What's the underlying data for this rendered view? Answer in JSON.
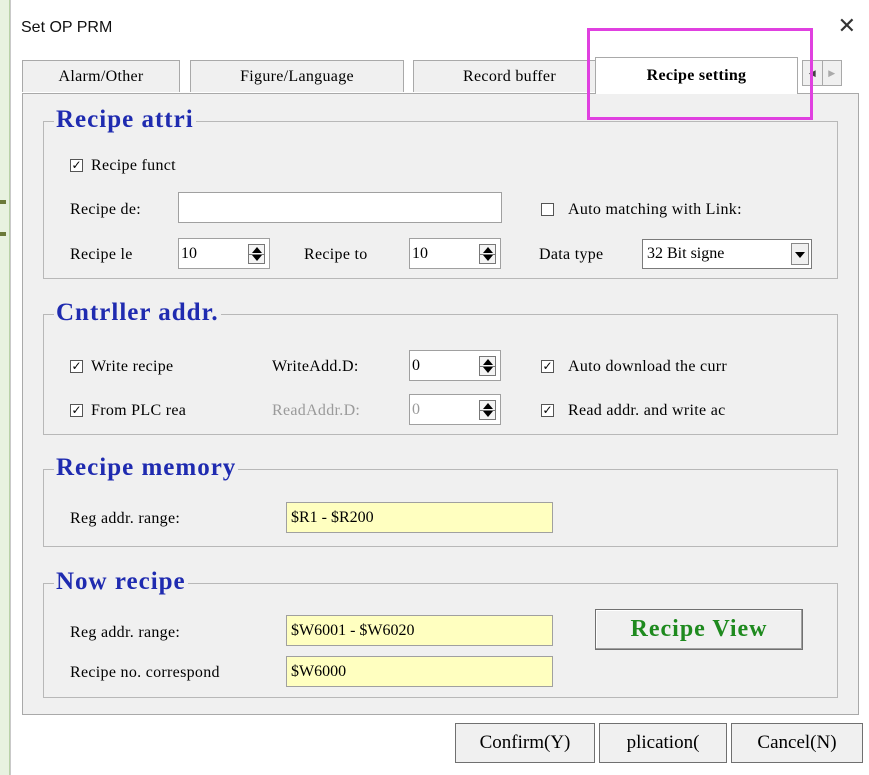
{
  "window": {
    "title": "Set OP PRM",
    "close_label": "✕"
  },
  "tabs": [
    {
      "label": "Alarm/Other",
      "active": false
    },
    {
      "label": "Figure/Language",
      "active": false
    },
    {
      "label": "Record buffer",
      "active": false
    },
    {
      "label": "Recipe setting",
      "active": true
    }
  ],
  "tab_scroll": {
    "left": "◀",
    "right": "▶"
  },
  "recipe_attri": {
    "title": "Recipe attri",
    "recipe_funct": {
      "label": "Recipe funct",
      "checked": true
    },
    "recipe_desc": {
      "label": "Recipe de:",
      "value": ""
    },
    "auto_matching": {
      "label": "Auto matching with Link:",
      "checked": false
    },
    "recipe_length": {
      "label": "Recipe le",
      "value": "10"
    },
    "recipe_total": {
      "label": "Recipe to",
      "value": "10"
    },
    "data_type": {
      "label": "Data type",
      "value": "32 Bit signe"
    }
  },
  "controller_addr": {
    "title": "Cntrller addr.",
    "write_recipe": {
      "label": "Write recipe",
      "checked": true
    },
    "write_addr": {
      "label": "WriteAdd.D:",
      "value": "0"
    },
    "auto_download": {
      "label": "Auto download the curr",
      "checked": true
    },
    "from_plc": {
      "label": "From PLC rea",
      "checked": true
    },
    "read_addr": {
      "label": "ReadAddr.D:",
      "value": "0"
    },
    "read_write_addr": {
      "label": "Read addr. and write ac",
      "checked": true
    }
  },
  "recipe_memory": {
    "title": "Recipe memory",
    "range_label": "Reg addr. range:",
    "range_value": "$R1 - $R200"
  },
  "now_recipe": {
    "title": "Now recipe",
    "range_label": "Reg addr. range:",
    "range_value": "$W6001 - $W6020",
    "no_label": "Recipe no. correspond",
    "no_value": "$W6000",
    "view_button": "Recipe View"
  },
  "buttons": {
    "confirm": "Confirm(Y)",
    "application": "plication(",
    "cancel": "Cancel(N)"
  },
  "colors": {
    "group_title": "#1f2bb0",
    "recipe_view": "#1e8a1e",
    "highlight": "#e040e0",
    "address_field": "#ffffc0"
  }
}
